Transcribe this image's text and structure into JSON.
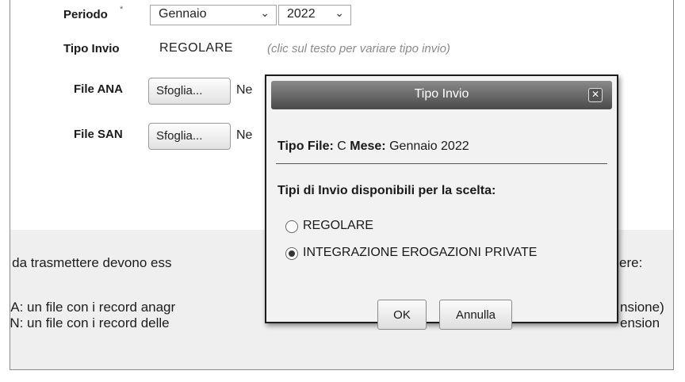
{
  "form": {
    "periodo_label": "Periodo",
    "required_mark": "*",
    "month_value": "Gennaio",
    "year_value": "2022",
    "tipo_invio_label": "Tipo Invio",
    "tipo_invio_value": "REGOLARE",
    "tipo_invio_hint": "(clic sul testo per variare tipo invio)",
    "file_ana_label": "File ANA",
    "file_san_label": "File SAN",
    "browse_label": "Sfoglia...",
    "no_file_text": "Ne"
  },
  "info": {
    "line1_left": "e da trasmettere devono ess",
    "line1_right": "ere:",
    "line2_left": "NA: un file con i record anagr",
    "line2_right": "nsione)",
    "line3_left": "AN: un file con i record delle",
    "line3_right": "ension"
  },
  "dialog": {
    "title": "Tipo Invio",
    "close_glyph": "✕",
    "tipo_file_label": "Tipo File:",
    "tipo_file_value": "C",
    "mese_label": "Mese:",
    "mese_value": "Gennaio 2022",
    "heading": "Tipi di Invio disponibili per la scelta:",
    "options": [
      {
        "label": "REGOLARE",
        "checked": false
      },
      {
        "label": "INTEGRAZIONE EROGAZIONI PRIVATE",
        "checked": true
      }
    ],
    "ok_label": "OK",
    "cancel_label": "Annulla"
  },
  "icons": {
    "dropdown": "chevron-down-icon",
    "close": "close-icon",
    "radio_unchecked": "radio-unchecked-icon",
    "radio_checked": "radio-checked-icon"
  },
  "colors": {
    "title_bar": "#5a5a5a",
    "dialog_bg": "#f2f2f2",
    "info_bg": "#efefef",
    "hint": "#8a8a8a"
  }
}
